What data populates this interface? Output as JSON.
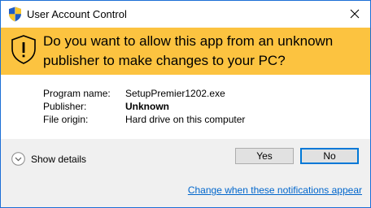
{
  "window": {
    "title": "User Account Control",
    "border_color": "#1c6fd6"
  },
  "title_bar": {
    "icon": "uac-shield-icon",
    "close_icon": "close-icon"
  },
  "banner": {
    "background": "#fcc340",
    "icon": "warning-shield-icon",
    "question": "Do you want to allow this app from an unknown publisher to make changes to your PC?"
  },
  "details": {
    "rows": [
      {
        "label": "Program name:",
        "value": "SetupPremier1202.exe",
        "bold": false
      },
      {
        "label": "Publisher:",
        "value": "Unknown",
        "bold": true
      },
      {
        "label": "File origin:",
        "value": "Hard drive on this computer",
        "bold": false
      }
    ]
  },
  "footer": {
    "show_details_label": "Show details",
    "show_details_icon": "chevron-down-circle-icon",
    "yes_label": "Yes",
    "no_label": "No",
    "notifications_link": "Change when these notifications appear",
    "link_color": "#0066cc",
    "default_button_border": "#0078d7"
  }
}
